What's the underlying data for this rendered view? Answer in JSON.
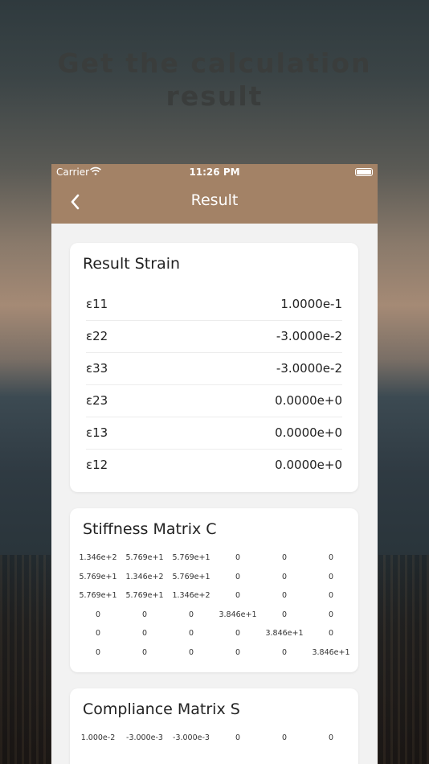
{
  "headline": {
    "line1": "Get the calculation",
    "line2": "result"
  },
  "status_bar": {
    "carrier": "Carrier",
    "time": "11:26 PM"
  },
  "nav": {
    "title": "Result",
    "back_icon": "chevron-left-icon"
  },
  "colors": {
    "nav": "#a38266",
    "background": "#f2f2f2",
    "card": "#ffffff"
  },
  "strain_card": {
    "title": "Result Strain",
    "rows": [
      {
        "label": "ε11",
        "value": "1.0000e-1"
      },
      {
        "label": "ε22",
        "value": "-3.0000e-2"
      },
      {
        "label": "ε33",
        "value": "-3.0000e-2"
      },
      {
        "label": "ε23",
        "value": "0.0000e+0"
      },
      {
        "label": "ε13",
        "value": "0.0000e+0"
      },
      {
        "label": "ε12",
        "value": "0.0000e+0"
      }
    ]
  },
  "stiffness_card": {
    "title": "Stiffness Matrix C",
    "rows": [
      [
        "1.346e+2",
        "5.769e+1",
        "5.769e+1",
        "0",
        "0",
        "0"
      ],
      [
        "5.769e+1",
        "1.346e+2",
        "5.769e+1",
        "0",
        "0",
        "0"
      ],
      [
        "5.769e+1",
        "5.769e+1",
        "1.346e+2",
        "0",
        "0",
        "0"
      ],
      [
        "0",
        "0",
        "0",
        "3.846e+1",
        "0",
        "0"
      ],
      [
        "0",
        "0",
        "0",
        "0",
        "3.846e+1",
        "0"
      ],
      [
        "0",
        "0",
        "0",
        "0",
        "0",
        "3.846e+1"
      ]
    ]
  },
  "compliance_card": {
    "title": "Compliance Matrix S",
    "rows": [
      [
        "1.000e-2",
        "-3.000e-3",
        "-3.000e-3",
        "0",
        "0",
        "0"
      ]
    ]
  }
}
